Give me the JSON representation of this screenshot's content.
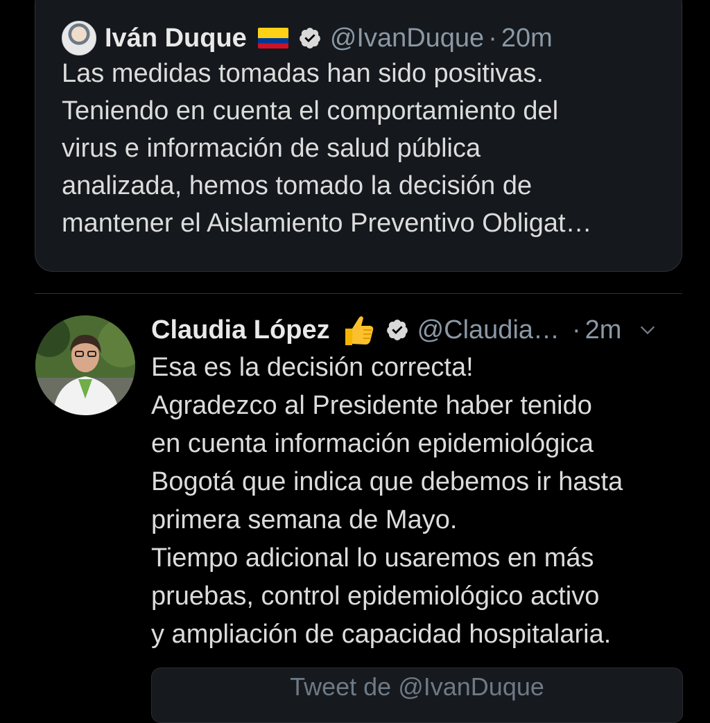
{
  "quoted_tweet": {
    "author_name": "Iván Duque",
    "handle": "@IvanDuque",
    "separator": "·",
    "time": "20m",
    "flag_icon": "colombia-flag-icon",
    "verified_icon": "verified-badge-icon",
    "text_lines": [
      "Las medidas tomadas han sido positivas.",
      "Teniendo en cuenta el comportamiento del",
      "virus e información de salud pública",
      "analizada, hemos tomado la decisión de",
      "mantener el Aislamiento Preventivo Obligat…"
    ]
  },
  "tweet": {
    "author_name": "Claudia López",
    "handle": "@Claudia…",
    "separator": "·",
    "time": "2m",
    "emoji_icon": "thumbs-up-icon",
    "verified_icon": "verified-badge-icon",
    "menu_icon": "chevron-down-icon",
    "text_lines": [
      "Esa es la decisión correcta!",
      "Agradezco al Presidente haber tenido",
      "en cuenta información epidemiológica",
      "Bogotá que indica que debemos ir hasta",
      "primera semana de Mayo.",
      "Tiempo adicional lo usaremos en más",
      "pruebas, control epidemiológico activo",
      "y ampliación de capacidad hospitalaria."
    ]
  },
  "quote_link": {
    "label": "Tweet de @IvanDuque"
  },
  "colors": {
    "background": "#000000",
    "card": "#15181c",
    "text": "#dcdcdc",
    "secondary_text": "#8b98a5",
    "divider": "#2f3336"
  }
}
